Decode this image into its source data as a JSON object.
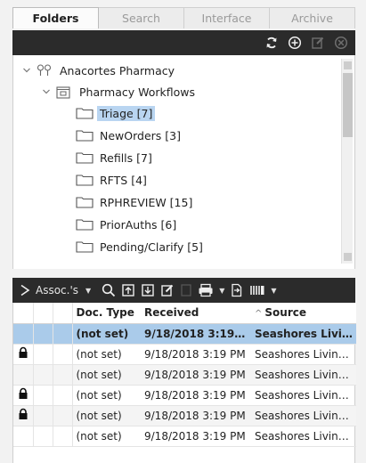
{
  "tabs": [
    {
      "label": "Folders",
      "active": true
    },
    {
      "label": "Search",
      "active": false
    },
    {
      "label": "Interface",
      "active": false
    },
    {
      "label": "Archive",
      "active": false
    }
  ],
  "toolbar_top": {
    "icons": [
      "refresh-icon",
      "add-icon",
      "edit-icon",
      "delete-icon"
    ]
  },
  "tree": {
    "root": {
      "label": "Anacortes Pharmacy",
      "icon": "organization-icon"
    },
    "group": {
      "label": "Pharmacy Workflows",
      "icon": "workflow-folder-icon"
    },
    "folders": [
      {
        "label": "Triage [7]",
        "selected": true
      },
      {
        "label": "NewOrders [3]"
      },
      {
        "label": "Refills [7]"
      },
      {
        "label": "RFTS [4]"
      },
      {
        "label": "RPHREVIEW [15]"
      },
      {
        "label": "PriorAuths [6]"
      },
      {
        "label": "Pending/Clarify [5]"
      }
    ]
  },
  "toolbar_bottom": {
    "assoc_label": "Assoc.'s"
  },
  "grid": {
    "columns": [
      "Doc. Type",
      "Received",
      "Source"
    ],
    "rows": [
      {
        "locked": false,
        "doc_type": "(not set)",
        "received": "9/18/2018 3:19 P...",
        "source": "Seashores Livin...",
        "selected": true
      },
      {
        "locked": true,
        "doc_type": "(not set)",
        "received": "9/18/2018 3:19 PM",
        "source": "Seashores Living..."
      },
      {
        "locked": false,
        "doc_type": "(not set)",
        "received": "9/18/2018 3:19 PM",
        "source": "Seashores Living..."
      },
      {
        "locked": true,
        "doc_type": "(not set)",
        "received": "9/18/2018 3:19 PM",
        "source": "Seashores Living..."
      },
      {
        "locked": true,
        "doc_type": "(not set)",
        "received": "9/18/2018 3:19 PM",
        "source": "Seashores Living..."
      },
      {
        "locked": false,
        "doc_type": "(not set)",
        "received": "9/18/2018 3:19 PM",
        "source": "Seashores Living..."
      }
    ]
  },
  "colors": {
    "toolbar": "#2b2b2b",
    "selection": "#aacbea",
    "tree_selection": "#b9d5f1"
  }
}
